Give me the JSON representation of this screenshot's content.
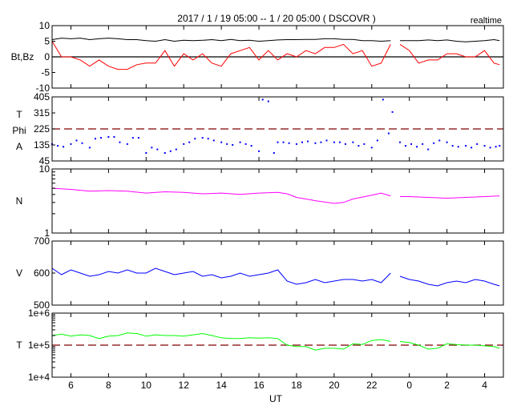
{
  "chart_data": [
    {
      "type": "line",
      "id": "mag",
      "title": "2017 / 1 / 19   05:00 --  1 / 20   05:00 ( DSCOVR )",
      "note": "realtime",
      "ylabel": [
        "Bt,Bz"
      ],
      "ylim": [
        -10,
        10
      ],
      "yscale": "linear",
      "yticks": [
        "10",
        "5",
        "0",
        "-5",
        "-10"
      ],
      "yticks_values": [
        10,
        5,
        0,
        -5,
        -10
      ],
      "refline": {
        "value": 0,
        "style": "solid",
        "color": "#000000"
      },
      "x": [
        5,
        5.5,
        6,
        6.5,
        7,
        7.5,
        8,
        8.5,
        9,
        9.5,
        10,
        10.5,
        11,
        11.5,
        12,
        12.5,
        13,
        13.5,
        14,
        14.5,
        15,
        15.5,
        16,
        16.5,
        17,
        17.5,
        18,
        18.5,
        19,
        19.5,
        20,
        20.5,
        21,
        21.5,
        22,
        22.5,
        23,
        null,
        23.5,
        24,
        24.5,
        25,
        25.5,
        26,
        26.5,
        27,
        27.5,
        28,
        28.5,
        28.8
      ],
      "series": [
        {
          "name": "Bt",
          "color": "#000000",
          "values": [
            5.5,
            6,
            5.8,
            6,
            5.5,
            5.8,
            6,
            5.8,
            5.5,
            5.5,
            5.2,
            5,
            5.5,
            5,
            5.3,
            5.2,
            5.3,
            5.5,
            5.2,
            5.6,
            5.2,
            5.3,
            5,
            5.2,
            5.4,
            5.5,
            5.5,
            5.6,
            5.6,
            5.8,
            5.8,
            5.6,
            5.6,
            5.2,
            5.2,
            5,
            5.2,
            null,
            5.2,
            5.2,
            5.2,
            5.4,
            5.2,
            5.4,
            5,
            4.8,
            5.0,
            5.2,
            5.5,
            5.2
          ]
        },
        {
          "name": "Bz",
          "color": "#ff0000",
          "values": [
            5,
            0,
            0,
            -1,
            -3,
            -1,
            -3,
            -4,
            -4,
            -2.5,
            -2,
            -2,
            2,
            -3,
            1,
            -1,
            1,
            -2,
            -3,
            1,
            2,
            3,
            -1,
            2,
            -1,
            1,
            0,
            2,
            1,
            3,
            3,
            4,
            1,
            2,
            -3,
            -2,
            4,
            null,
            4,
            2,
            -2,
            -1,
            -1,
            1,
            1,
            0,
            0,
            2,
            -2,
            -2.5
          ]
        }
      ]
    },
    {
      "type": "scatter",
      "id": "phi",
      "ylabel": [
        "T",
        "Phi",
        "A"
      ],
      "ylim": [
        45,
        405
      ],
      "yscale": "linear",
      "yticks": [
        "405",
        "315",
        "225",
        "135",
        "45"
      ],
      "yticks_values": [
        405,
        315,
        225,
        135,
        45
      ],
      "refline": {
        "value": 225,
        "style": "dashed",
        "color": "#800000"
      },
      "series": [
        {
          "name": "Phi",
          "color": "#0000ff",
          "x": [
            5,
            5.3,
            5.6,
            6,
            6.3,
            6.6,
            7,
            7.3,
            7.6,
            8,
            8.3,
            8.6,
            9,
            9.3,
            9.6,
            10,
            10.3,
            10.6,
            11,
            11.3,
            11.6,
            12,
            12.3,
            12.6,
            13,
            13.3,
            13.6,
            14,
            14.3,
            14.6,
            15,
            15.3,
            15.6,
            16,
            16.2,
            16.5,
            16.8,
            17,
            17.3,
            17.6,
            18,
            18.3,
            18.6,
            19,
            19.3,
            19.6,
            20,
            20.3,
            20.6,
            21,
            21.3,
            21.6,
            22,
            22.3,
            22.6,
            22.9,
            23.1,
            23.5,
            23.8,
            24.1,
            24.4,
            24.7,
            25,
            25.3,
            25.6,
            26,
            26.3,
            26.6,
            27,
            27.3,
            27.6,
            28,
            28.3,
            28.6,
            28.8
          ],
          "values": [
            140,
            130,
            125,
            140,
            160,
            145,
            120,
            170,
            175,
            180,
            180,
            150,
            140,
            175,
            175,
            90,
            120,
            110,
            90,
            100,
            110,
            140,
            150,
            170,
            175,
            170,
            160,
            150,
            140,
            135,
            150,
            140,
            130,
            100,
            390,
            380,
            90,
            150,
            150,
            145,
            140,
            150,
            155,
            145,
            150,
            160,
            150,
            150,
            140,
            150,
            130,
            140,
            120,
            160,
            390,
            200,
            320,
            150,
            130,
            140,
            125,
            140,
            110,
            145,
            160,
            150,
            130,
            125,
            130,
            120,
            140,
            130,
            120,
            125,
            130
          ]
        }
      ]
    },
    {
      "type": "line",
      "id": "density",
      "ylabel": [
        "N"
      ],
      "ylim": [
        1,
        10
      ],
      "yscale": "log",
      "yticks": [
        "10",
        "1"
      ],
      "yticks_values": [
        10,
        1
      ],
      "x": [
        5,
        6,
        7,
        8,
        9,
        10,
        11,
        12,
        13,
        14,
        15,
        16,
        17,
        17.5,
        18,
        19,
        20,
        20.5,
        21,
        22,
        22.5,
        23,
        null,
        23.5,
        24,
        25,
        26,
        27,
        28,
        28.8
      ],
      "series": [
        {
          "name": "N",
          "color": "#ff00ff",
          "values": [
            5.0,
            4.8,
            4.5,
            4.6,
            4.5,
            4.2,
            4.4,
            4.3,
            4.1,
            4.2,
            4.0,
            4.2,
            4.3,
            4.1,
            3.6,
            3.2,
            2.9,
            3.0,
            3.4,
            3.9,
            4.2,
            3.8,
            null,
            3.7,
            3.7,
            3.6,
            3.5,
            3.6,
            3.7,
            3.8
          ]
        }
      ]
    },
    {
      "type": "line",
      "id": "speed",
      "ylabel": [
        "V"
      ],
      "ylim": [
        500,
        700
      ],
      "yscale": "linear",
      "yticks": [
        "700",
        "600",
        "500"
      ],
      "yticks_values": [
        700,
        600,
        500
      ],
      "x": [
        5,
        5.5,
        6,
        6.5,
        7,
        7.5,
        8,
        8.5,
        9,
        9.5,
        10,
        10.5,
        11,
        11.5,
        12,
        12.5,
        13,
        13.5,
        14,
        14.5,
        15,
        15.5,
        16,
        16.5,
        17,
        17.5,
        18,
        18.5,
        19,
        19.5,
        20,
        20.5,
        21,
        21.5,
        22,
        22.5,
        23,
        null,
        23.5,
        24,
        24.5,
        25,
        25.5,
        26,
        26.5,
        27,
        27.5,
        28,
        28.5,
        28.8
      ],
      "series": [
        {
          "name": "V",
          "color": "#0000ff",
          "values": [
            615,
            595,
            610,
            600,
            590,
            595,
            605,
            600,
            610,
            600,
            600,
            615,
            605,
            595,
            600,
            605,
            590,
            595,
            585,
            590,
            600,
            590,
            595,
            600,
            610,
            575,
            565,
            570,
            580,
            570,
            575,
            580,
            580,
            575,
            580,
            570,
            600,
            null,
            590,
            580,
            575,
            565,
            560,
            570,
            575,
            570,
            580,
            575,
            565,
            560
          ]
        }
      ]
    },
    {
      "type": "line",
      "id": "temperature",
      "ylabel": [
        "T"
      ],
      "ylim": [
        10000,
        1000000
      ],
      "yscale": "log",
      "yticks": [
        "1e+6",
        "1e+5",
        "1e+4"
      ],
      "yticks_values": [
        1000000,
        100000,
        10000
      ],
      "refline": {
        "value": 100000,
        "style": "dashed",
        "color": "#800000"
      },
      "x": [
        5,
        5.5,
        6,
        6.5,
        7,
        7.5,
        8,
        8.5,
        9,
        9.5,
        10,
        10.5,
        11,
        11.5,
        12,
        12.5,
        13,
        13.5,
        14,
        14.5,
        15,
        15.5,
        16,
        16.5,
        17,
        17.5,
        18,
        18.5,
        19,
        19.5,
        20,
        20.5,
        21,
        21.5,
        22,
        22.5,
        23,
        null,
        23.5,
        24,
        24.5,
        25,
        25.5,
        26,
        26.5,
        27,
        27.5,
        28,
        28.5,
        28.8
      ],
      "series": [
        {
          "name": "T",
          "color": "#00ff00",
          "values": [
            200000,
            220000,
            190000,
            210000,
            200000,
            160000,
            190000,
            200000,
            240000,
            230000,
            190000,
            210000,
            200000,
            200000,
            190000,
            210000,
            230000,
            200000,
            170000,
            160000,
            160000,
            170000,
            165000,
            170000,
            160000,
            100000,
            90000,
            90000,
            70000,
            80000,
            80000,
            75000,
            110000,
            105000,
            140000,
            150000,
            130000,
            null,
            130000,
            120000,
            100000,
            75000,
            80000,
            110000,
            105000,
            100000,
            100000,
            95000,
            90000,
            80000
          ]
        }
      ]
    }
  ],
  "xaxis": {
    "label": "UT",
    "xlim": [
      5,
      29
    ],
    "ticks": [
      "6",
      "8",
      "10",
      "12",
      "14",
      "16",
      "18",
      "20",
      "22",
      "0",
      "2",
      "4"
    ],
    "ticks_values": [
      6,
      8,
      10,
      12,
      14,
      16,
      18,
      20,
      22,
      24,
      26,
      28
    ]
  }
}
